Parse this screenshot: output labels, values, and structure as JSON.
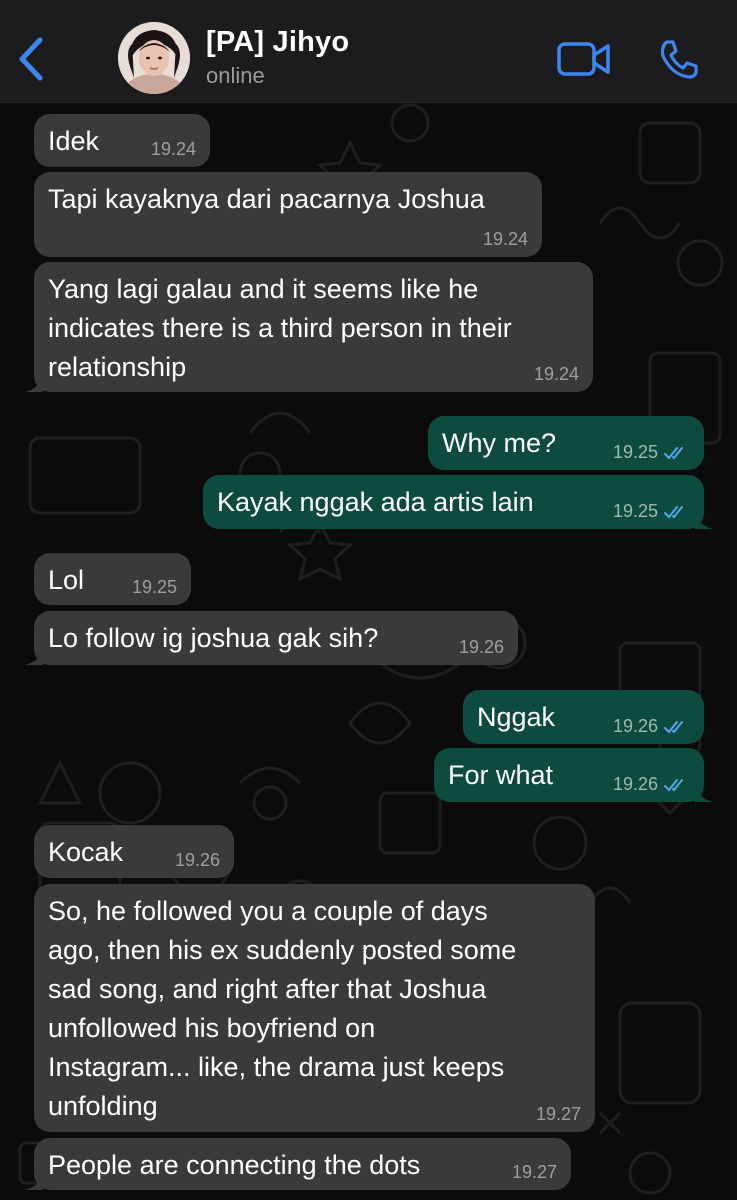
{
  "header": {
    "title": "[PA] Jihyo",
    "subtitle": "online",
    "back_icon": "chevron-left-icon",
    "video_icon": "video-camera-icon",
    "call_icon": "phone-icon",
    "accent": "#3b86f0"
  },
  "colors": {
    "incoming_bubble": "#3a3a3c",
    "outgoing_bubble": "#0d4b3f",
    "read_ticks": "#4fa9f0"
  },
  "messages": [
    {
      "direction": "incoming",
      "lines": [
        "Idek"
      ],
      "time": "19.24"
    },
    {
      "direction": "incoming",
      "lines": [
        "Tapi kayaknya dari pacarnya Joshua"
      ],
      "time": "19.24"
    },
    {
      "direction": "incoming",
      "lines": [
        "Yang lagi galau and it seems like he",
        "indicates there is a third person in their",
        "relationship"
      ],
      "time": "19.24"
    },
    {
      "direction": "outgoing",
      "lines": [
        "Why me?"
      ],
      "time": "19.25",
      "status": "read"
    },
    {
      "direction": "outgoing",
      "lines": [
        "Kayak nggak ada artis lain"
      ],
      "time": "19.25",
      "status": "read"
    },
    {
      "direction": "incoming",
      "lines": [
        "Lol"
      ],
      "time": "19.25"
    },
    {
      "direction": "incoming",
      "lines": [
        "Lo follow ig joshua gak sih?"
      ],
      "time": "19.26"
    },
    {
      "direction": "outgoing",
      "lines": [
        "Nggak"
      ],
      "time": "19.26",
      "status": "read"
    },
    {
      "direction": "outgoing",
      "lines": [
        "For what"
      ],
      "time": "19.26",
      "status": "read"
    },
    {
      "direction": "incoming",
      "lines": [
        "Kocak"
      ],
      "time": "19.26"
    },
    {
      "direction": "incoming",
      "lines": [
        "So, he followed you a couple of days",
        "ago, then his ex suddenly posted some",
        "sad song, and right after that Joshua",
        "unfollowed his boyfriend on",
        "Instagram... like, the drama just keeps",
        "unfolding"
      ],
      "time": "19.27"
    },
    {
      "direction": "incoming",
      "lines": [
        "People are connecting the dots"
      ],
      "time": "19.27"
    }
  ]
}
